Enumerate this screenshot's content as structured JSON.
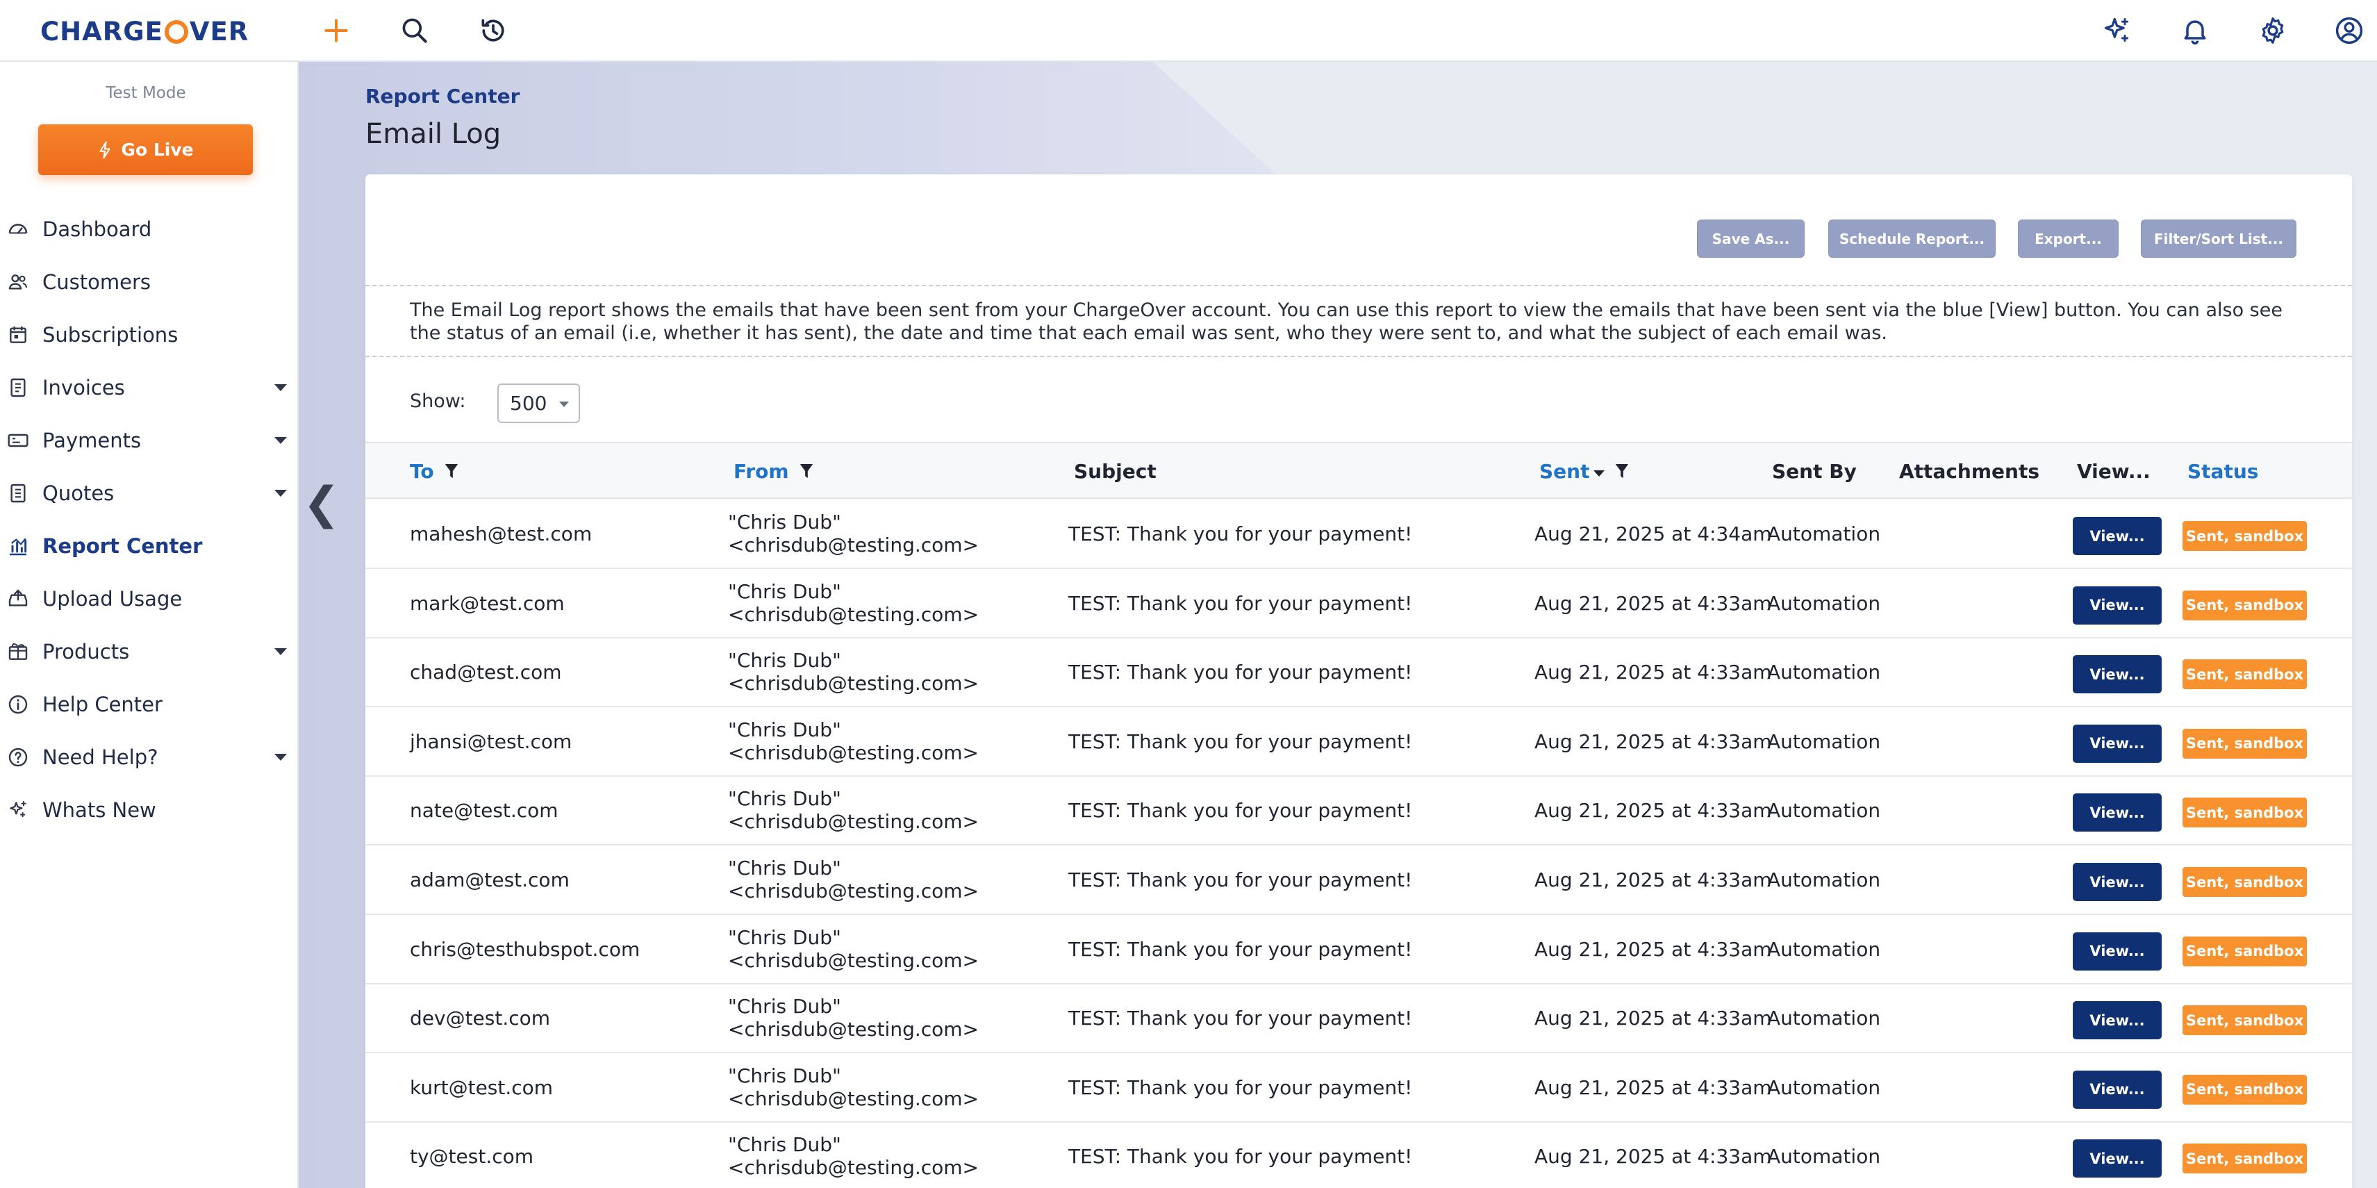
{
  "brand": {
    "logo_left": "CHARGE",
    "logo_right": "VER"
  },
  "sidebar": {
    "test_mode": "Test Mode",
    "go_live": "Go Live",
    "items": [
      {
        "label": "Dashboard",
        "icon": "gauge-icon",
        "caret": false
      },
      {
        "label": "Customers",
        "icon": "users-icon",
        "caret": false
      },
      {
        "label": "Subscriptions",
        "icon": "calendar-icon",
        "caret": false
      },
      {
        "label": "Invoices",
        "icon": "invoice-icon",
        "caret": true
      },
      {
        "label": "Payments",
        "icon": "payment-card-icon",
        "caret": true
      },
      {
        "label": "Quotes",
        "icon": "quote-document-icon",
        "caret": true
      },
      {
        "label": "Report Center",
        "icon": "chart-icon",
        "caret": false,
        "active": true
      },
      {
        "label": "Upload Usage",
        "icon": "upload-icon",
        "caret": false
      },
      {
        "label": "Products",
        "icon": "box-icon",
        "caret": true
      },
      {
        "label": "Help Center",
        "icon": "info-icon",
        "caret": false
      },
      {
        "label": "Need Help?",
        "icon": "question-icon",
        "caret": true
      },
      {
        "label": "Whats New",
        "icon": "sparkles-icon",
        "caret": false
      }
    ]
  },
  "header": {
    "breadcrumb": "Report Center",
    "title": "Email Log"
  },
  "toolbar": {
    "save_as": "Save As...",
    "schedule": "Schedule Report...",
    "export": "Export...",
    "filter": "Filter/Sort List..."
  },
  "description": "The Email Log report shows the emails that have been sent from your ChargeOver account. You can use this report to view the emails that have been sent via the blue [View] button. You can also see the status of an email (i.e, whether it has sent), the date and time that each email was sent, who they were sent to, and what the subject of each email was.",
  "show": {
    "label": "Show:",
    "value": "500"
  },
  "table": {
    "columns": {
      "to": "To",
      "from": "From",
      "subject": "Subject",
      "sent": "Sent",
      "sent_by": "Sent By",
      "attachments": "Attachments",
      "view": "View...",
      "status": "Status"
    },
    "rows": [
      {
        "to": "mahesh@test.com",
        "from_name": "\"Chris Dub\"",
        "from_email": "<chrisdub@testing.com>",
        "subject": "TEST: Thank you for your payment!",
        "sent": "Aug 21, 2025 at 4:34am",
        "sent_by": "Automation",
        "attachments": "",
        "view": "View...",
        "status": "Sent, sandbox"
      },
      {
        "to": "mark@test.com",
        "from_name": "\"Chris Dub\"",
        "from_email": "<chrisdub@testing.com>",
        "subject": "TEST: Thank you for your payment!",
        "sent": "Aug 21, 2025 at 4:33am",
        "sent_by": "Automation",
        "attachments": "",
        "view": "View...",
        "status": "Sent, sandbox"
      },
      {
        "to": "chad@test.com",
        "from_name": "\"Chris Dub\"",
        "from_email": "<chrisdub@testing.com>",
        "subject": "TEST: Thank you for your payment!",
        "sent": "Aug 21, 2025 at 4:33am",
        "sent_by": "Automation",
        "attachments": "",
        "view": "View...",
        "status": "Sent, sandbox"
      },
      {
        "to": "jhansi@test.com",
        "from_name": "\"Chris Dub\"",
        "from_email": "<chrisdub@testing.com>",
        "subject": "TEST: Thank you for your payment!",
        "sent": "Aug 21, 2025 at 4:33am",
        "sent_by": "Automation",
        "attachments": "",
        "view": "View...",
        "status": "Sent, sandbox"
      },
      {
        "to": "nate@test.com",
        "from_name": "\"Chris Dub\"",
        "from_email": "<chrisdub@testing.com>",
        "subject": "TEST: Thank you for your payment!",
        "sent": "Aug 21, 2025 at 4:33am",
        "sent_by": "Automation",
        "attachments": "",
        "view": "View...",
        "status": "Sent, sandbox"
      },
      {
        "to": "adam@test.com",
        "from_name": "\"Chris Dub\"",
        "from_email": "<chrisdub@testing.com>",
        "subject": "TEST: Thank you for your payment!",
        "sent": "Aug 21, 2025 at 4:33am",
        "sent_by": "Automation",
        "attachments": "",
        "view": "View...",
        "status": "Sent, sandbox"
      },
      {
        "to": "chris@testhubspot.com",
        "from_name": "\"Chris Dub\"",
        "from_email": "<chrisdub@testing.com>",
        "subject": "TEST: Thank you for your payment!",
        "sent": "Aug 21, 2025 at 4:33am",
        "sent_by": "Automation",
        "attachments": "",
        "view": "View...",
        "status": "Sent, sandbox"
      },
      {
        "to": "dev@test.com",
        "from_name": "\"Chris Dub\"",
        "from_email": "<chrisdub@testing.com>",
        "subject": "TEST: Thank you for your payment!",
        "sent": "Aug 21, 2025 at 4:33am",
        "sent_by": "Automation",
        "attachments": "",
        "view": "View...",
        "status": "Sent, sandbox"
      },
      {
        "to": "kurt@test.com",
        "from_name": "\"Chris Dub\"",
        "from_email": "<chrisdub@testing.com>",
        "subject": "TEST: Thank you for your payment!",
        "sent": "Aug 21, 2025 at 4:33am",
        "sent_by": "Automation",
        "attachments": "",
        "view": "View...",
        "status": "Sent, sandbox"
      },
      {
        "to": "ty@test.com",
        "from_name": "\"Chris Dub\"",
        "from_email": "<chrisdub@testing.com>",
        "subject": "TEST: Thank you for your payment!",
        "sent": "Aug 21, 2025 at 4:33am",
        "sent_by": "Automation",
        "attachments": "",
        "view": "View...",
        "status": "Sent, sandbox"
      }
    ]
  },
  "colors": {
    "brand_blue": "#1c3c8a",
    "accent_orange": "#f58220",
    "view_button": "#0f3173",
    "status_badge": "#f8922e",
    "link_blue": "#1f73c8"
  }
}
